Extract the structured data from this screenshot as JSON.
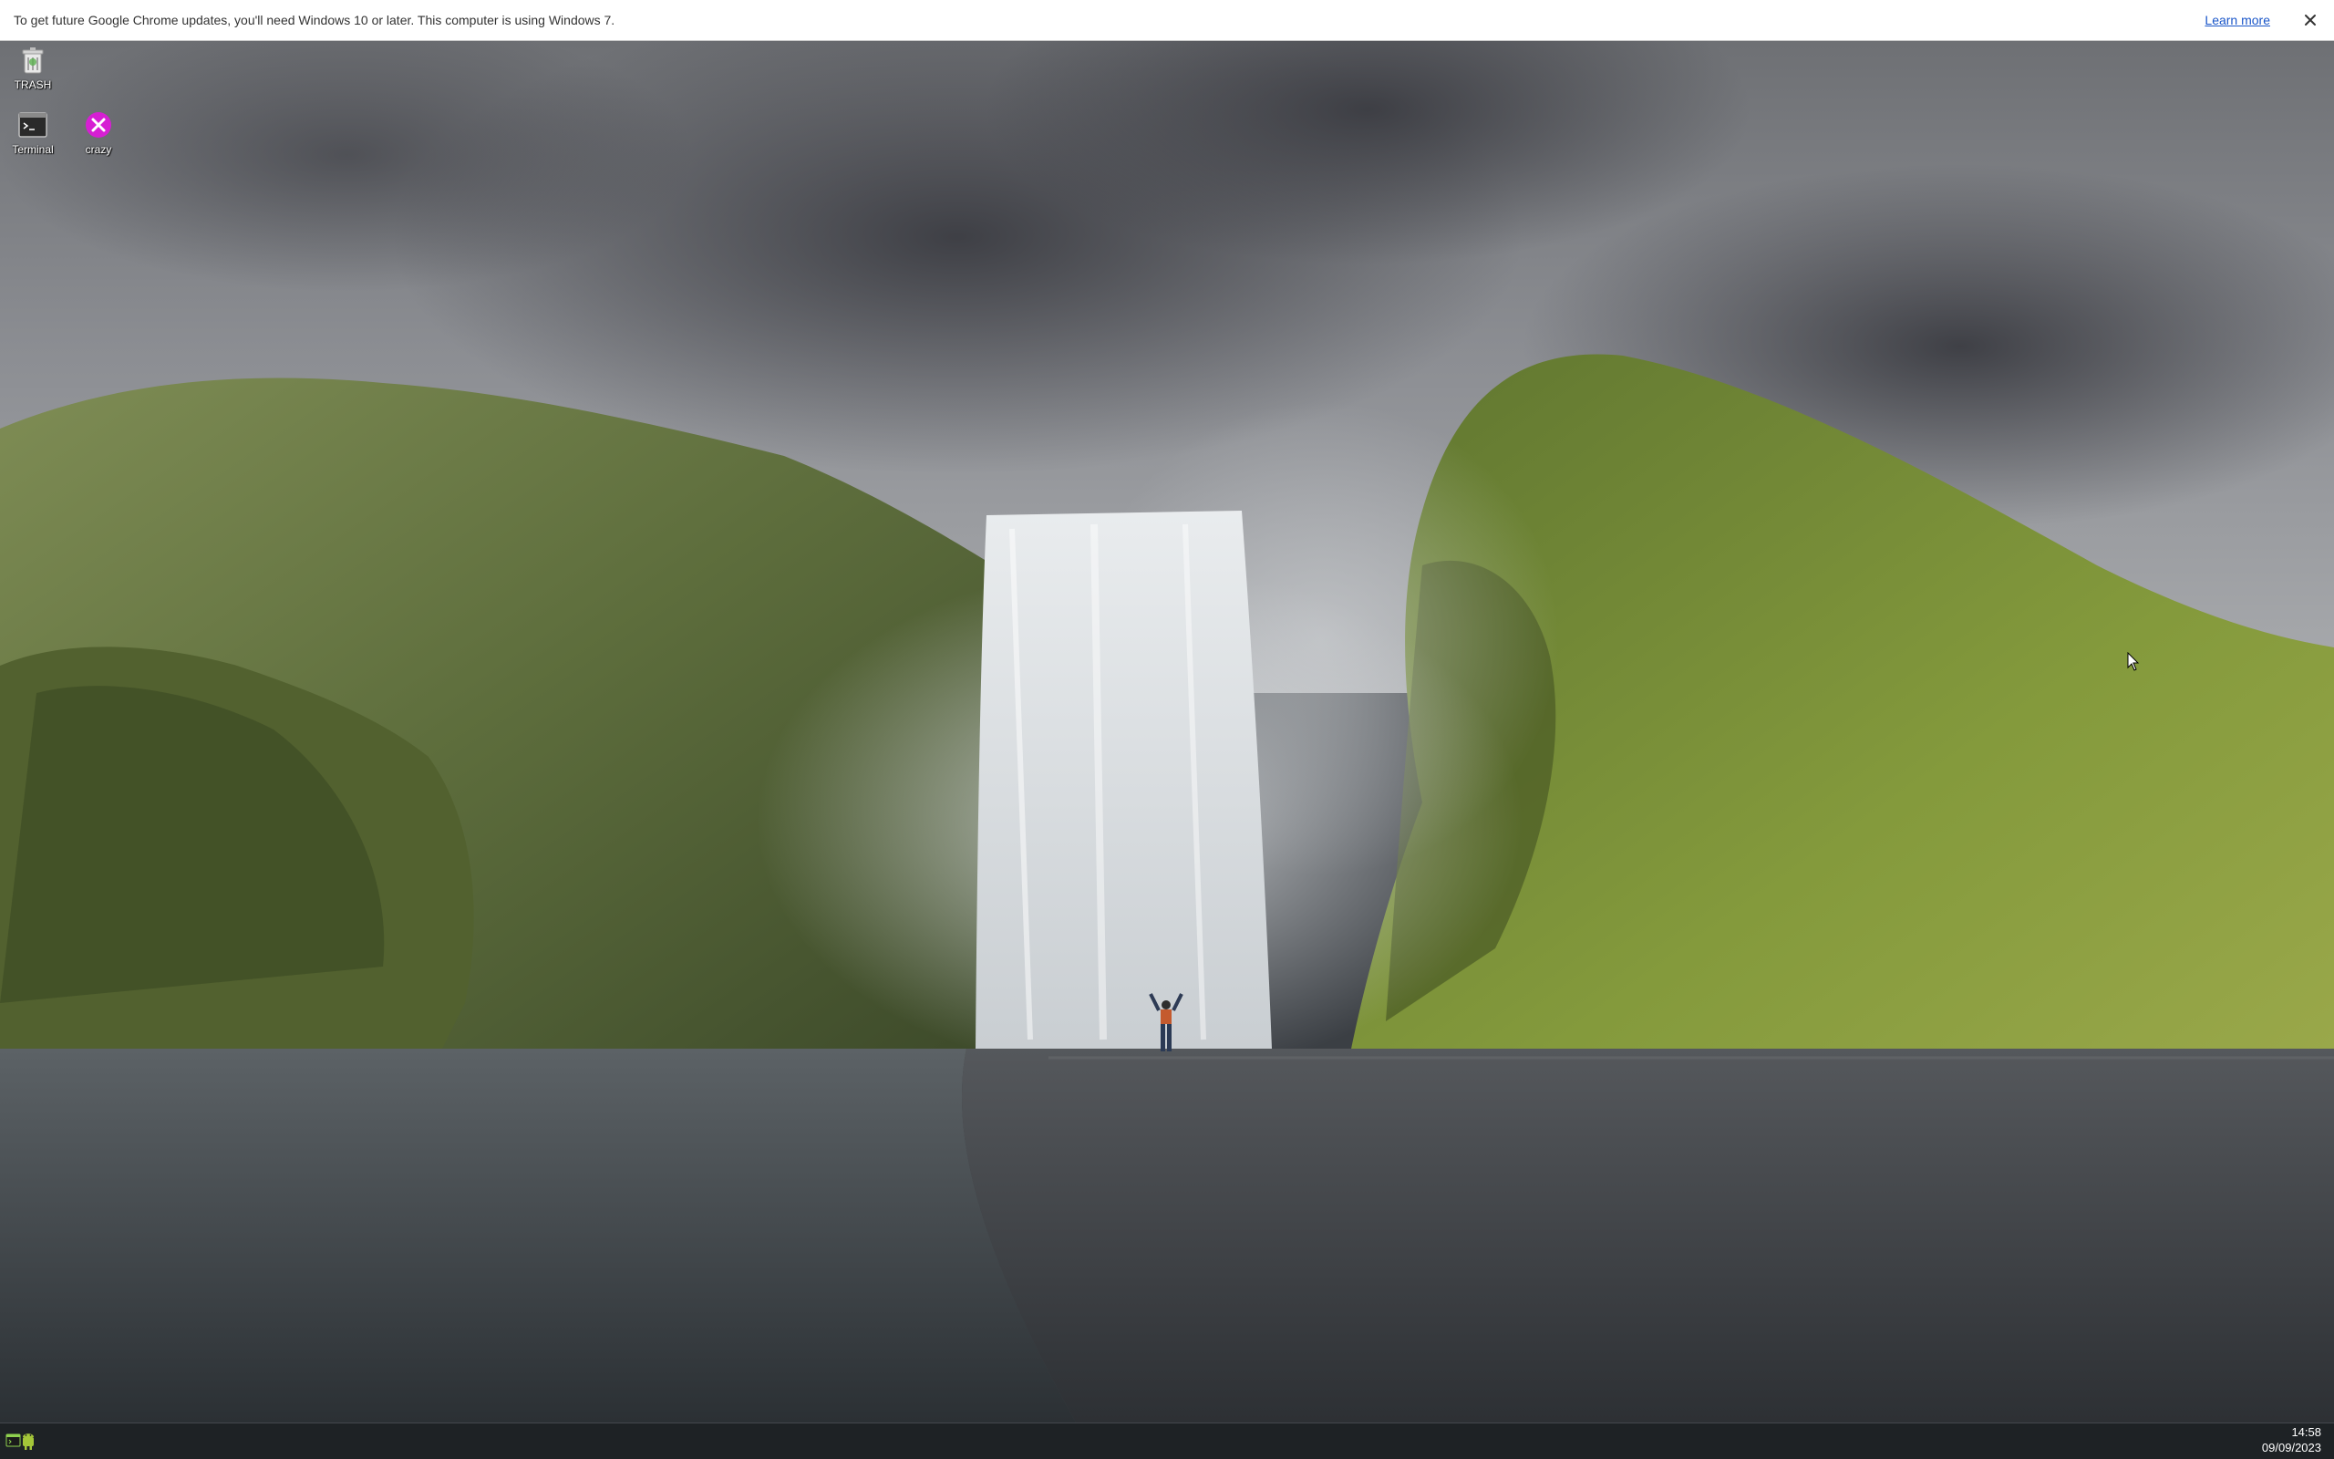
{
  "notification_bar": {
    "message": "To get future Google Chrome updates, you'll need Windows 10 or later. This computer is using Windows 7.",
    "link_label": "Learn more",
    "close_icon": "close-icon"
  },
  "desktop": {
    "wallpaper": "waterfall-landscape",
    "icons": [
      {
        "label": "TRASH",
        "icon": "trash-icon"
      },
      {
        "label": "Terminal",
        "icon": "terminal-icon"
      },
      {
        "label": "crazy",
        "icon": "crazy-x-icon"
      }
    ]
  },
  "taskbar": {
    "apps": [
      {
        "icon": "terminal-app-icon"
      },
      {
        "icon": "android-app-icon"
      }
    ],
    "clock": {
      "time": "14:58",
      "date": "09/09/2023"
    }
  },
  "colors": {
    "link": "#1a56c9",
    "crazy_icon": "#d61fd3",
    "taskbar": "#1c1f23"
  }
}
